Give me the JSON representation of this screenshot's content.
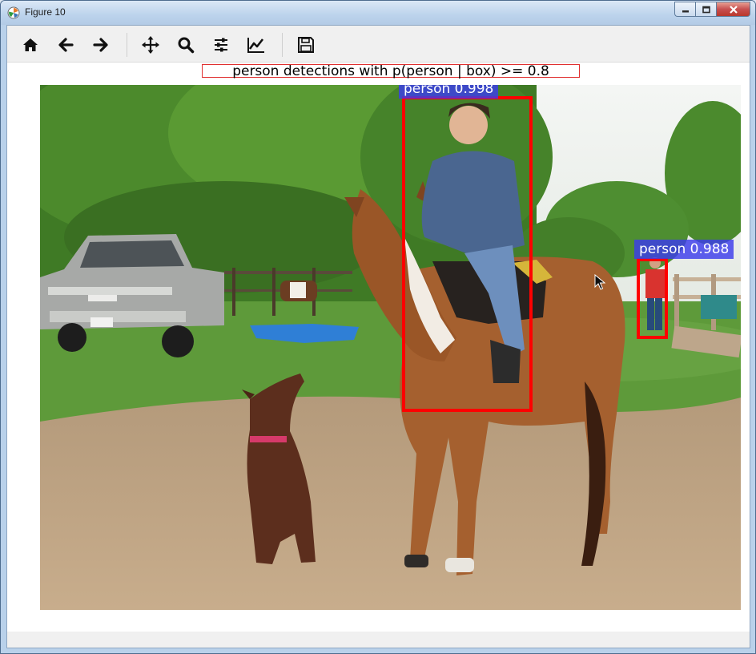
{
  "window": {
    "title": "Figure 10",
    "app_icon": "matplotlib-icon",
    "controls": {
      "minimize": "minimize-icon",
      "maximize": "maximize-icon",
      "close": "close-icon"
    }
  },
  "toolbar": {
    "buttons": [
      {
        "icon": "home-icon"
      },
      {
        "icon": "back-arrow-icon"
      },
      {
        "icon": "forward-arrow-icon"
      },
      {
        "icon": "pan-move-icon"
      },
      {
        "icon": "zoom-magnifier-icon"
      },
      {
        "icon": "configure-subplots-icon"
      },
      {
        "icon": "edit-curves-icon"
      },
      {
        "icon": "save-floppy-icon"
      }
    ]
  },
  "figure": {
    "title": "person detections with p(person | box) >= 0.8",
    "detections": [
      {
        "label": "person 0.998"
      },
      {
        "label": "person 0.988"
      }
    ]
  },
  "colors": {
    "box": "#ff0000",
    "label_bg": "#3c3ceb",
    "toolbar_bg": "#f0f0f0"
  }
}
